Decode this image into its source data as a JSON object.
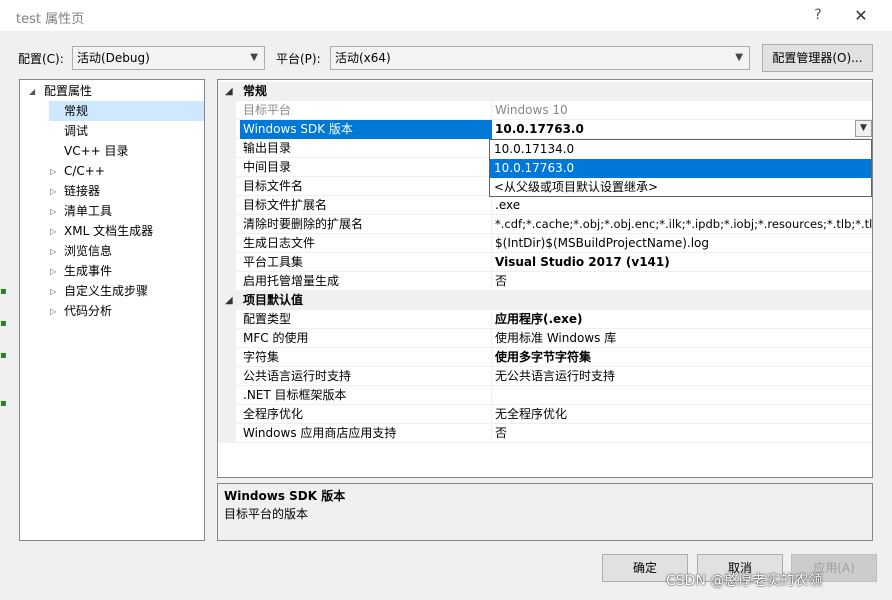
{
  "window": {
    "title": "test 属性页",
    "help": "?",
    "close": "✕"
  },
  "config": {
    "config_label": "配置(C):",
    "config_value": "活动(Debug)",
    "platform_label": "平台(P):",
    "platform_value": "活动(x64)",
    "manager_button": "配置管理器(O)..."
  },
  "tree": {
    "root": "配置属性",
    "items": [
      {
        "label": "常规",
        "expandable": false,
        "selected": true
      },
      {
        "label": "调试",
        "expandable": false
      },
      {
        "label": "VC++ 目录",
        "expandable": false
      },
      {
        "label": "C/C++",
        "expandable": true
      },
      {
        "label": "链接器",
        "expandable": true
      },
      {
        "label": "清单工具",
        "expandable": true
      },
      {
        "label": "XML 文档生成器",
        "expandable": true
      },
      {
        "label": "浏览信息",
        "expandable": true
      },
      {
        "label": "生成事件",
        "expandable": true
      },
      {
        "label": "自定义生成步骤",
        "expandable": true
      },
      {
        "label": "代码分析",
        "expandable": true
      }
    ]
  },
  "grid": {
    "cat1": "常规",
    "cat2": "项目默认值",
    "general": [
      {
        "name": "目标平台",
        "value": "Windows 10"
      },
      {
        "name": "Windows SDK 版本",
        "value": "10.0.17763.0"
      },
      {
        "name": "输出目录",
        "value": ""
      },
      {
        "name": "中间目录",
        "value": ""
      },
      {
        "name": "目标文件名",
        "value": ""
      },
      {
        "name": "目标文件扩展名",
        "value": ".exe"
      },
      {
        "name": "清除时要删除的扩展名",
        "value": "*.cdf;*.cache;*.obj;*.obj.enc;*.ilk;*.ipdb;*.iobj;*.resources;*.tlb;*.tli;*.t"
      },
      {
        "name": "生成日志文件",
        "value": "$(IntDir)$(MSBuildProjectName).log"
      },
      {
        "name": "平台工具集",
        "value": "Visual Studio 2017 (v141)"
      },
      {
        "name": "启用托管增量生成",
        "value": "否"
      }
    ],
    "defaults": [
      {
        "name": "配置类型",
        "value": "应用程序(.exe)"
      },
      {
        "name": "MFC 的使用",
        "value": "使用标准 Windows 库"
      },
      {
        "name": "字符集",
        "value": "使用多字节字符集"
      },
      {
        "name": "公共语言运行时支持",
        "value": "无公共语言运行时支持"
      },
      {
        "name": ".NET 目标框架版本",
        "value": ""
      },
      {
        "name": "全程序优化",
        "value": "无全程序优化"
      },
      {
        "name": "Windows 应用商店应用支持",
        "value": "否"
      }
    ]
  },
  "sdk_dropdown": {
    "options": [
      "10.0.17134.0",
      "10.0.17763.0",
      "<从父级或项目默认设置继承>"
    ],
    "highlighted_index": 1
  },
  "description": {
    "title": "Windows SDK 版本",
    "text": "目标平台的版本"
  },
  "buttons": {
    "ok": "确定",
    "cancel": "取消",
    "apply": "应用(A)"
  },
  "watermark": "CSDN @憨厚老实的农领",
  "colors": {
    "selection": "#0078d7",
    "tree_selection": "#cde8ff",
    "window_bg": "#f0f0f0"
  }
}
